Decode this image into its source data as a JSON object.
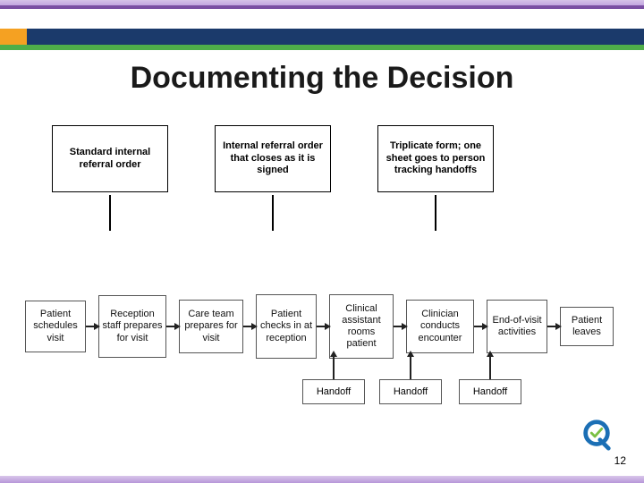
{
  "title": "Documenting the Decision",
  "callouts": [
    "Standard internal referral order",
    "Internal referral order that closes as it is signed",
    "Triplicate form; one sheet goes to person tracking handoffs"
  ],
  "flow": [
    "Patient schedules visit",
    "Reception staff prepares for visit",
    "Care team prepares for visit",
    "Patient checks in at reception",
    "Clinical assistant rooms patient",
    "Clinician conducts encounter",
    "End-of-visit activities",
    "Patient leaves"
  ],
  "handoff": "Handoff",
  "page_number": "12"
}
